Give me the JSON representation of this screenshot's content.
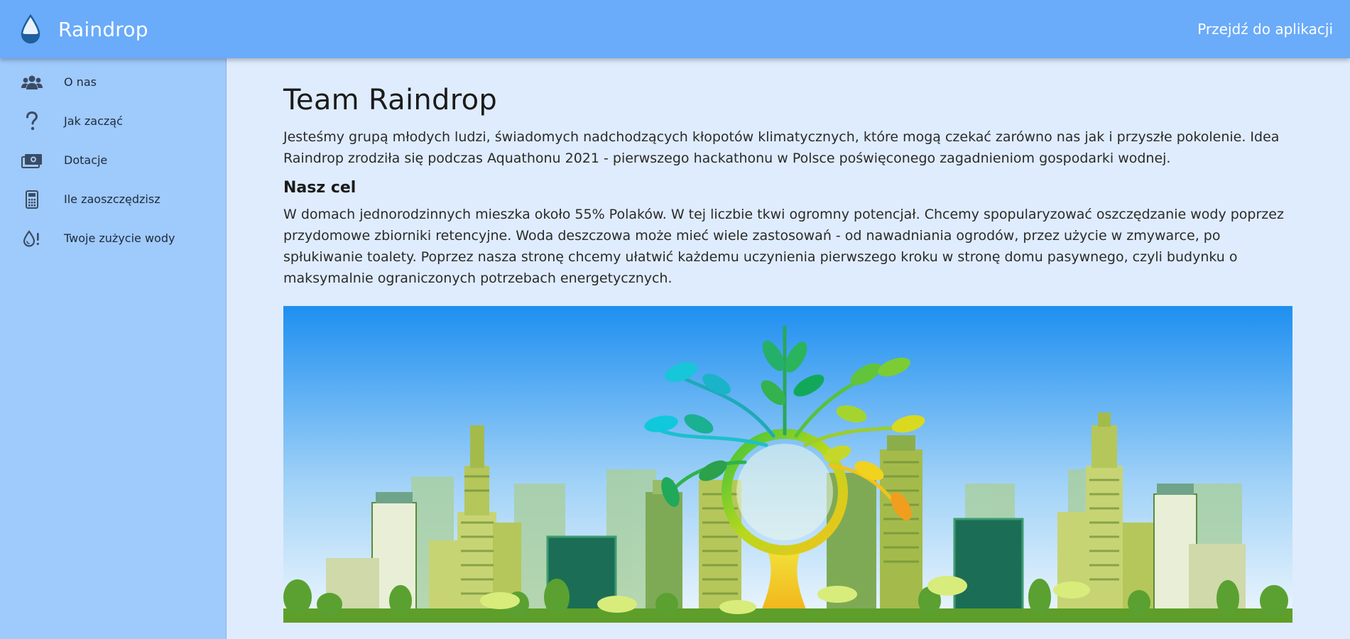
{
  "header": {
    "brand_name": "Raindrop",
    "brand_icon": "water-drop-icon",
    "app_link_label": "Przejdź do aplikacji"
  },
  "sidebar": {
    "items": [
      {
        "label": "O nas",
        "icon": "users-icon"
      },
      {
        "label": "Jak zacząć",
        "icon": "question-icon"
      },
      {
        "label": "Dotacje",
        "icon": "money-icon"
      },
      {
        "label": "Ile zaoszczędzisz",
        "icon": "calculator-icon"
      },
      {
        "label": "Twoje zużycie wody",
        "icon": "drop-alert-icon"
      }
    ]
  },
  "main": {
    "title": "Team Raindrop",
    "intro": "Jesteśmy grupą młodych ludzi, świadomych nadchodzących kłopotów klimatycznych, które mogą czekać zarówno nas jak i przyszłe pokolenie. Idea Raindrop zrodziła się podczas Aquathonu 2021 - pierwszego hackathonu w Polsce poświęconego zagadnieniom gospodarki wodnej.",
    "goal_heading": "Nasz cel",
    "goal_text": "W domach jednorodzinnych mieszka około 55% Polaków. W tej liczbie tkwi ogromny potencjał. Chcemy spopularyzować oszczędzanie wody poprzez przydomowe zbiorniki retencyjne. Woda deszczowa może mieć wiele zastosowań - od nawadniania ogrodów, przez użycie w zmywarce, po spłukiwanie toalety. Poprzez nasza stronę chcemy ułatwić każdemu uczynienia pierwszego kroku w stronę domu pasywnego, czyli budynku o maksymalnie ograniczonych potrzebach energetycznych."
  },
  "colors": {
    "header_bg": "#6aabfa",
    "sidebar_bg": "#9fcafc",
    "page_bg": "#dfecfd"
  }
}
